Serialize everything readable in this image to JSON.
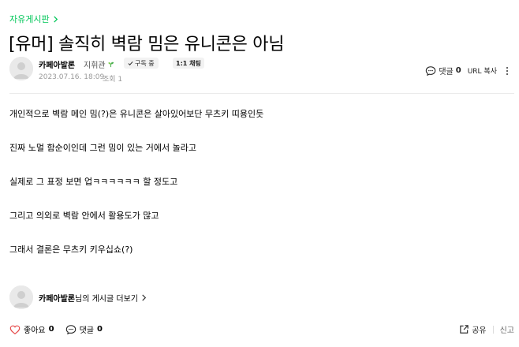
{
  "breadcrumb": {
    "board": "자유게시판"
  },
  "post": {
    "title": "[유머] 솔직히 벽람 밈은 유니콘은 아님",
    "author": "카페아발론",
    "level": "지휘관",
    "subscribe_label": "구독 중",
    "chat_label": "1:1 채팅",
    "date": "2023.07.16. 18:09",
    "views": "조회 1",
    "comment_label": "댓글",
    "comment_count": "0",
    "url_copy_label": "URL 복사",
    "body": [
      "개인적으로 벽람 메인 밈(?)은 유니콘은 살아있어보단 무츠키 띠용인듯",
      "진짜 노멀 함순이인데 그런 밈이 있는 거에서 놀라고",
      "실제로 그 표정 보면 업ㅋㅋㅋㅋㅋㅋ 할 정도고",
      "그리고 의외로 벽람 안에서 활용도가 많고",
      "그래서 결론은 무츠키 키우십쇼(?)"
    ]
  },
  "profile_link": {
    "author": "카페아발론",
    "suffix": "님의 게시글 더보기"
  },
  "footer": {
    "like_label": "좋아요",
    "like_count": "0",
    "comment_label": "댓글",
    "comment_count": "0",
    "share_label": "공유",
    "report_label": "신고"
  },
  "colors": {
    "accent": "#03c75a",
    "like": "#e54848"
  }
}
